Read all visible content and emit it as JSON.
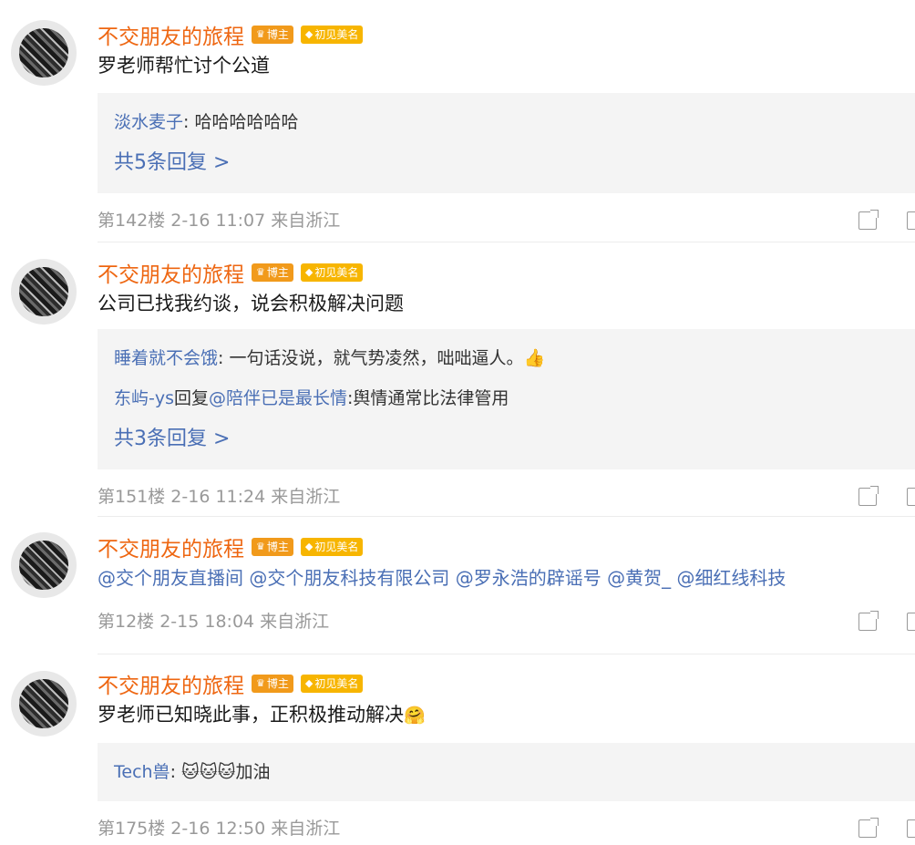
{
  "comments": [
    {
      "user": "不交朋友的旅程",
      "badge_host": "博主",
      "badge_fan": "初见美名",
      "text": "罗老师帮忙讨个公道",
      "replies": [
        {
          "user": "淡水麦子",
          "sep": ": ",
          "text": "哈哈哈哈哈哈"
        }
      ],
      "more_replies": "共5条回复 >",
      "meta": "第142楼 2-16 11:07 来自浙江"
    },
    {
      "user": "不交朋友的旅程",
      "badge_host": "博主",
      "badge_fan": "初见美名",
      "text": "公司已找我约谈，说会积极解决问题",
      "replies": [
        {
          "user": "睡着就不会饿",
          "sep": ": ",
          "text": "一句话没说，就气势凌然，咄咄逼人。",
          "emoji": "👍"
        },
        {
          "user": "东屿-ys",
          "reply_word": "回复",
          "mention": "@陪伴已是最长情",
          "text": ":舆情通常比法律管用"
        }
      ],
      "more_replies": "共3条回复 >",
      "meta": "第151楼 2-16 11:24 来自浙江"
    },
    {
      "user": "不交朋友的旅程",
      "badge_host": "博主",
      "badge_fan": "初见美名",
      "mentions": [
        "@交个朋友直播间",
        "@交个朋友科技有限公司",
        "@罗永浩的辟谣号",
        "@黄贺_",
        "@细红线科技"
      ],
      "meta": "第12楼 2-15 18:04 来自浙江"
    },
    {
      "user": "不交朋友的旅程",
      "badge_host": "博主",
      "badge_fan": "初见美名",
      "text": "罗老师已知晓此事，正积极推动解决",
      "text_emoji": "🤗",
      "replies": [
        {
          "user": "Tech兽",
          "sep": ": ",
          "emoji": "🐱🐱🐱",
          "text": "加油"
        }
      ],
      "meta": "第175楼 2-16 12:50 来自浙江"
    }
  ]
}
